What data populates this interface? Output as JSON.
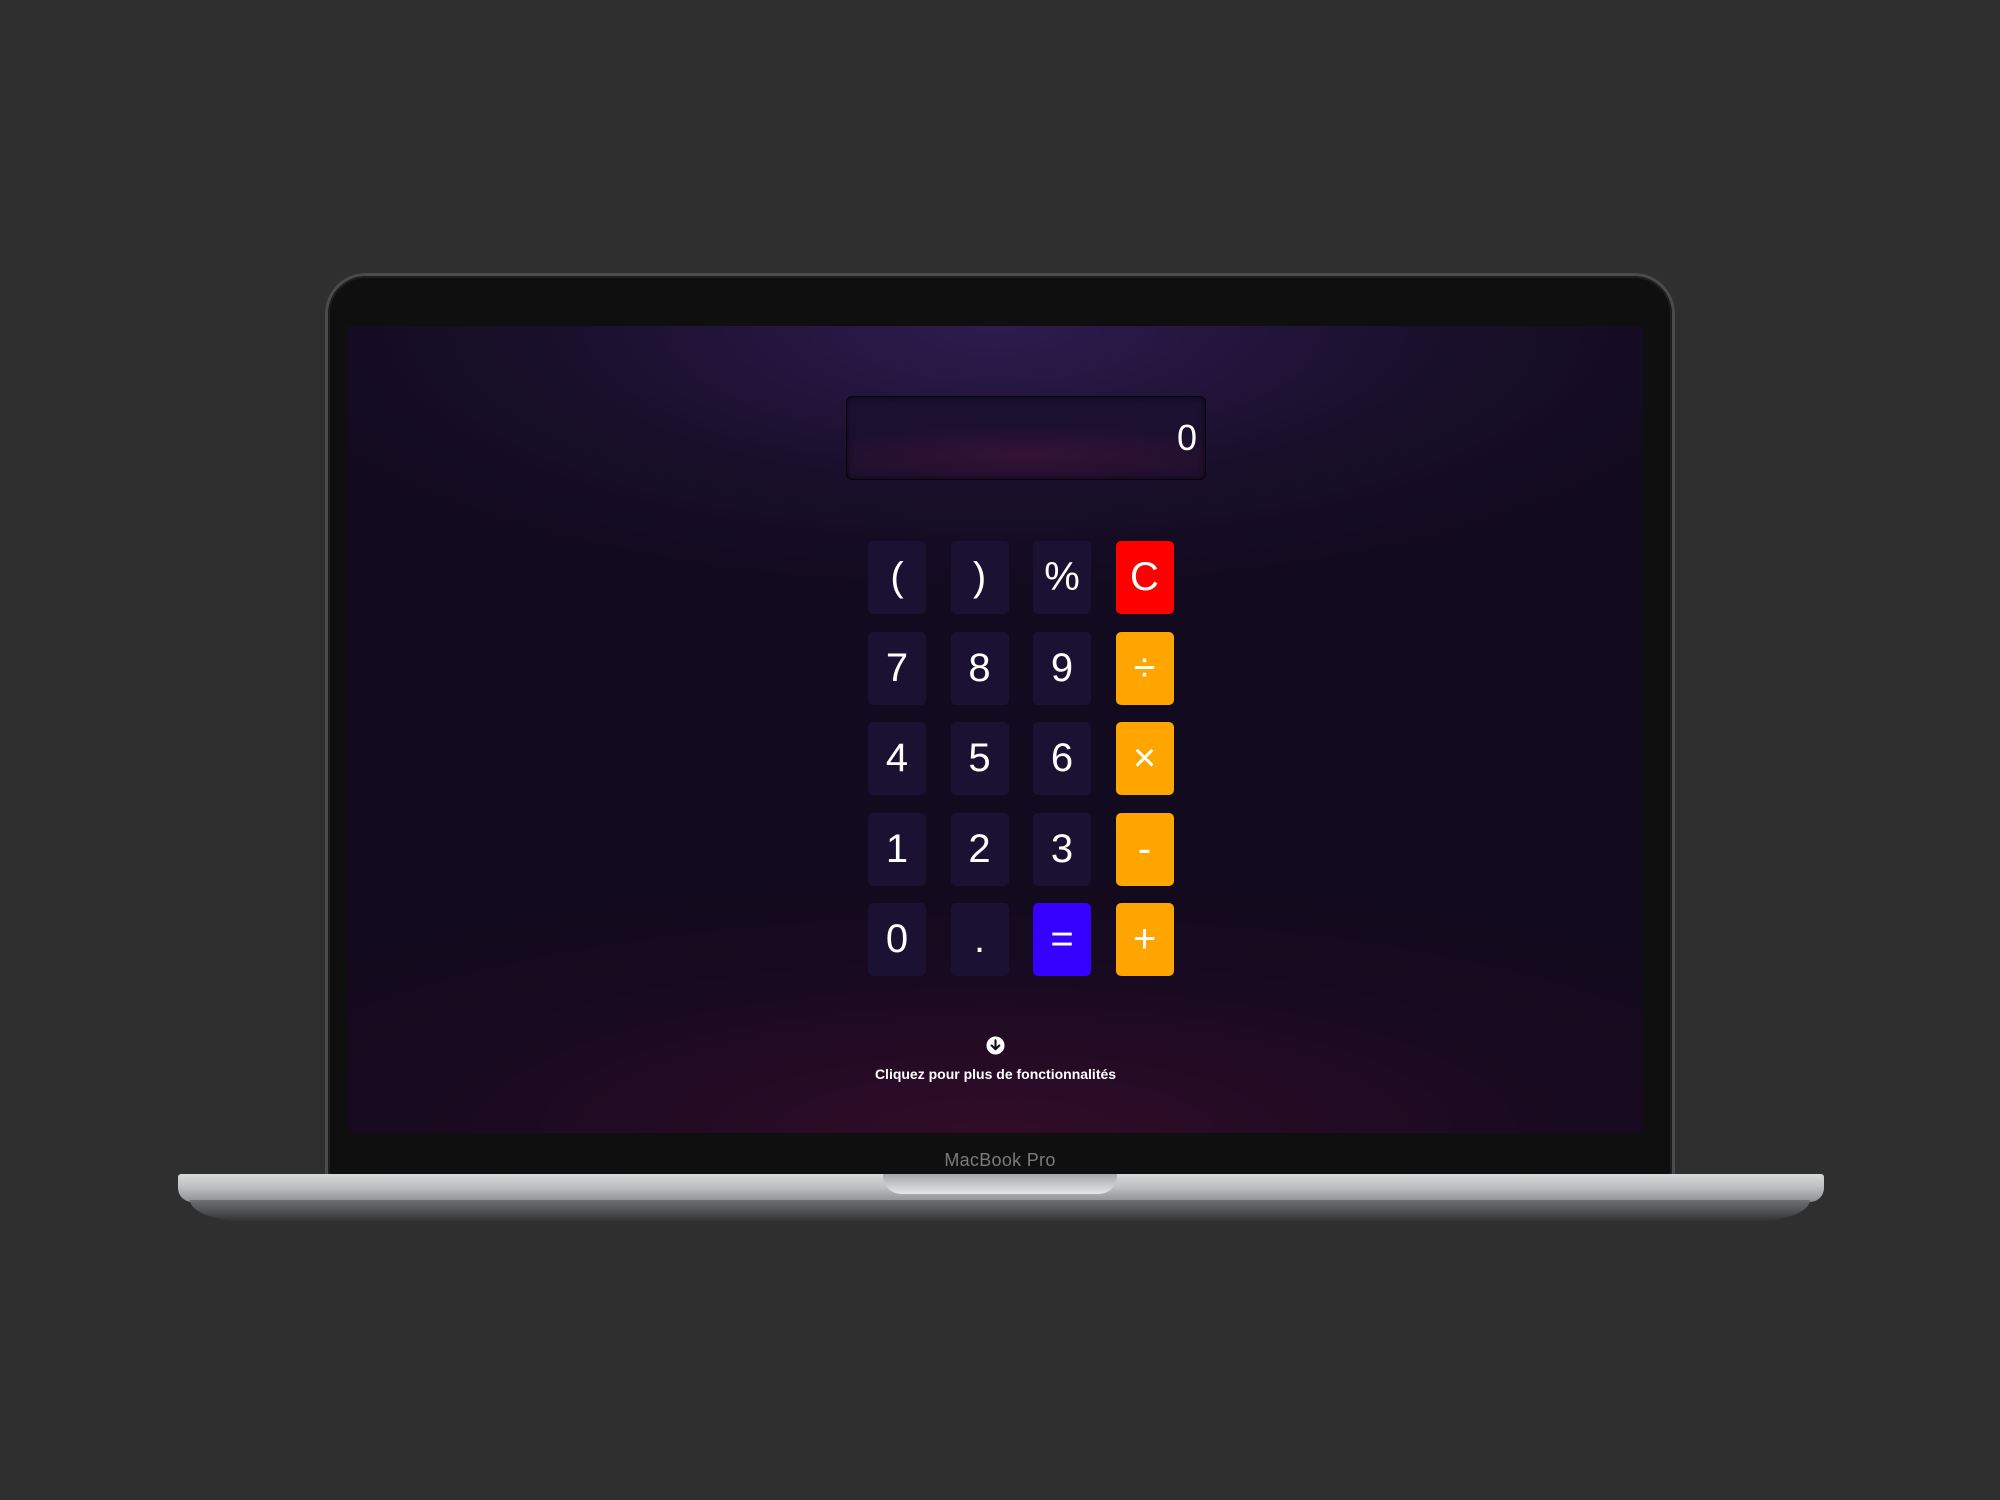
{
  "device": {
    "brand_label": "MacBook Pro"
  },
  "calculator": {
    "display": "0",
    "keys": [
      {
        "label": "(",
        "kind": "num",
        "name": "key-open-paren"
      },
      {
        "label": ")",
        "kind": "num",
        "name": "key-close-paren"
      },
      {
        "label": "%",
        "kind": "num",
        "name": "key-percent"
      },
      {
        "label": "C",
        "kind": "clear",
        "name": "key-clear"
      },
      {
        "label": "7",
        "kind": "num",
        "name": "key-7"
      },
      {
        "label": "8",
        "kind": "num",
        "name": "key-8"
      },
      {
        "label": "9",
        "kind": "num",
        "name": "key-9"
      },
      {
        "label": "÷",
        "kind": "op",
        "name": "key-divide"
      },
      {
        "label": "4",
        "kind": "num",
        "name": "key-4"
      },
      {
        "label": "5",
        "kind": "num",
        "name": "key-5"
      },
      {
        "label": "6",
        "kind": "num",
        "name": "key-6"
      },
      {
        "label": "×",
        "kind": "op",
        "name": "key-multiply"
      },
      {
        "label": "1",
        "kind": "num",
        "name": "key-1"
      },
      {
        "label": "2",
        "kind": "num",
        "name": "key-2"
      },
      {
        "label": "3",
        "kind": "num",
        "name": "key-3"
      },
      {
        "label": "-",
        "kind": "op",
        "name": "key-subtract"
      },
      {
        "label": "0",
        "kind": "num",
        "name": "key-0"
      },
      {
        "label": ".",
        "kind": "num",
        "name": "key-decimal"
      },
      {
        "label": "=",
        "kind": "eq",
        "name": "key-equals"
      },
      {
        "label": "+",
        "kind": "op",
        "name": "key-add"
      }
    ]
  },
  "more": {
    "icon": "arrow-down-circle-icon",
    "label": "Cliquez pour plus de fonctionnalités"
  },
  "colors": {
    "number_key": "#1b1233",
    "operator_key": "#ffa500",
    "clear_key": "#ff0000",
    "equals_key": "#3600ff",
    "outer_background": "#2e2f2e"
  }
}
